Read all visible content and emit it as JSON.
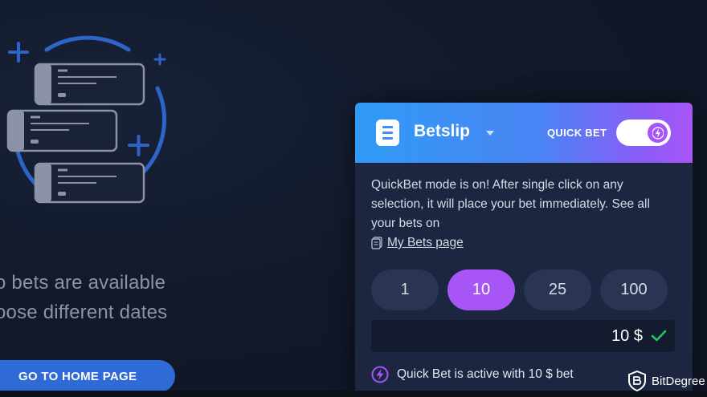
{
  "empty_state": {
    "line1": "o bets are available",
    "line2": "oose different dates",
    "home_button_label": "GO TO HOME PAGE"
  },
  "betslip": {
    "title": "Betslip",
    "quick_bet_label": "QUICK BET",
    "quick_bet_on": true,
    "info_text": "QuickBet mode is on! After single click on any selection, it will place your bet immediately. See all your bets on",
    "my_bets_link": "My Bets page",
    "stakes": [
      "1",
      "10",
      "25",
      "100"
    ],
    "selected_stake": "10",
    "amount_value": "10 $",
    "status_text": "Quick Bet is active with 10 $ bet"
  },
  "watermark": {
    "text": "BitDegree"
  },
  "colors": {
    "accent_purple": "#a855f7",
    "accent_blue": "#2e6bd6",
    "panel_bg": "#1d2640",
    "check_green": "#22c55e"
  },
  "icons": [
    "betslip-icon",
    "lightning-icon",
    "document-icon",
    "check-icon",
    "bitdegree-logo-icon",
    "plus-icon"
  ]
}
